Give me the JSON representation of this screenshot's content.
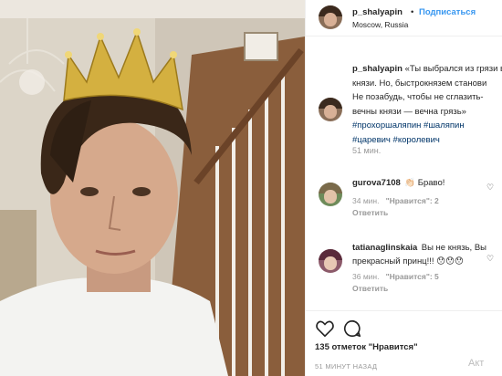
{
  "post": {
    "username": "p_shalyapin",
    "separator": "•",
    "follow_label": "Подписаться",
    "location": "Moscow, Russia"
  },
  "caption": {
    "username": "p_shalyapin",
    "line1": "«Ты выбрался из грязи в",
    "line2": "князи. Но, быстрокнязем станови",
    "line3": "Не позабудь, чтобы не сглазить-",
    "line4": "вечны князи — вечна грязь»",
    "tags": [
      "#прохоршаляпин",
      "#шаляпин",
      "#царевич",
      "#королевич"
    ],
    "time": "51 мин."
  },
  "comments": [
    {
      "username": "gurova7108",
      "text": "👏🏻 Браво!",
      "time": "34 мин.",
      "likes": "\"Нравится\": 2",
      "reply": "Ответить"
    },
    {
      "username": "tatianaglinskaia",
      "text_line1": "Вы не князь, Вы",
      "text_line2": "прекрасный принц!!! 😯😯😯",
      "time": "36 мин.",
      "likes": "\"Нравится\": 5",
      "reply": "Ответить"
    }
  ],
  "actions": {
    "likes_text": "135 отметок \"Нравится\"",
    "posted": "51 МИНУТ НАЗАД",
    "watermark": "Акт"
  },
  "icons": {
    "like": "heart-icon",
    "comment": "comment-icon",
    "small_like": "heart-small-icon"
  },
  "colors": {
    "link": "#3897f0",
    "hashtag": "#003569",
    "muted": "#999999"
  }
}
